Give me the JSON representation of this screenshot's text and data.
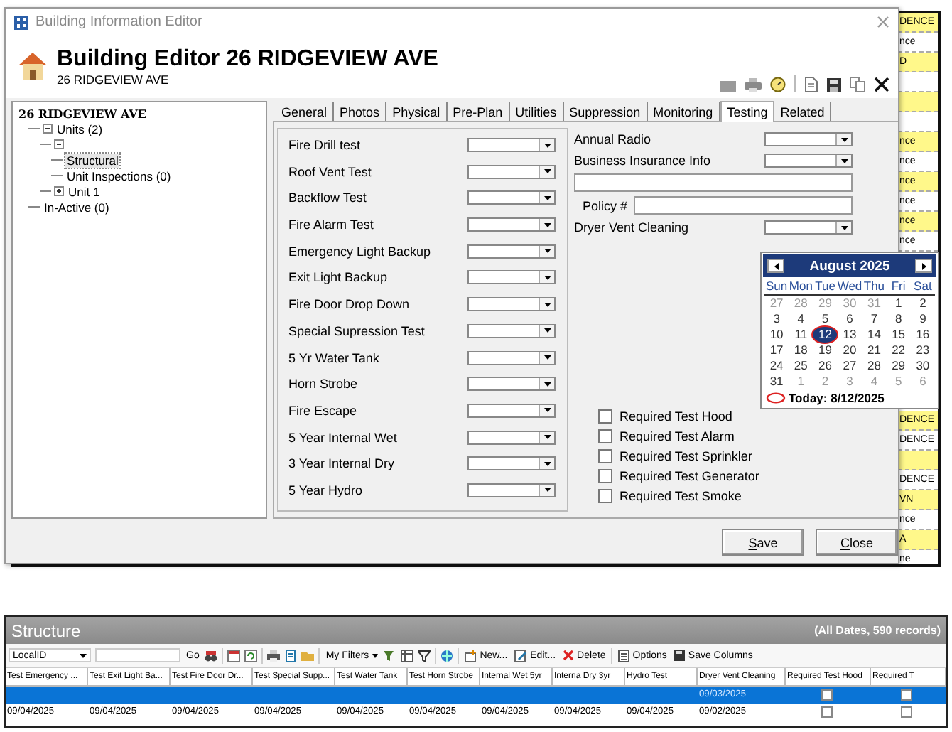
{
  "background_list": {
    "rows": [
      {
        "text": "DENCE",
        "highlighted": true
      },
      {
        "text": "nce",
        "highlighted": false
      },
      {
        "text": "D",
        "highlighted": true
      },
      {
        "highlighted": false
      },
      {
        "highlighted": true
      },
      {
        "highlighted": false
      },
      {
        "text": "nce",
        "highlighted": true
      },
      {
        "text": "nce",
        "highlighted": false
      },
      {
        "text": "nce",
        "highlighted": true
      },
      {
        "text": "nce",
        "highlighted": false
      },
      {
        "text": "nce",
        "highlighted": true
      },
      {
        "text": "nce",
        "highlighted": false
      }
    ],
    "rows_below_calendar": [
      {
        "text": "DENCE",
        "highlighted": true
      },
      {
        "text": "DENCE",
        "highlighted": false
      },
      {
        "highlighted": true
      },
      {
        "text": "DENCE",
        "highlighted": false
      },
      {
        "text": "VN",
        "highlighted": true
      },
      {
        "text": "nce",
        "highlighted": false
      },
      {
        "text": "A",
        "highlighted": true
      },
      {
        "text": "ne",
        "highlighted": false
      }
    ]
  },
  "dialog": {
    "title": "Building Information Editor",
    "heading": "Building Editor 26 RIDGEVIEW AVE",
    "subheading": "26 RIDGEVIEW AVE",
    "tree": [
      {
        "label": "26 RIDGEVIEW AVE",
        "selected": false,
        "children": [
          {
            "label": "Units (2)",
            "selected": false,
            "expanded": true,
            "children": [
              {
                "expanded": true,
                "children": [
                  {
                    "label": "Structural",
                    "selected": true
                  },
                  {
                    "label": "Unit Inspections (0)",
                    "selected": false
                  }
                ]
              },
              {
                "label": "Unit 1",
                "selected": false,
                "expanded": false
              }
            ]
          },
          {
            "label": "In-Active (0)",
            "selected": false
          }
        ]
      }
    ],
    "tabs": [
      {
        "label": "General",
        "selected": false
      },
      {
        "label": "Photos",
        "selected": false
      },
      {
        "label": "Physical",
        "selected": false
      },
      {
        "label": "Pre-Plan",
        "selected": false
      },
      {
        "label": "Utilities",
        "selected": false
      },
      {
        "label": "Suppression",
        "selected": false
      },
      {
        "label": "Monitoring",
        "selected": false
      },
      {
        "label": "Testing",
        "selected": true
      },
      {
        "label": "Related",
        "selected": false
      }
    ],
    "test_fields": [
      "Fire Drill test",
      "Roof Vent Test",
      "Backflow Test",
      "Fire Alarm Test",
      "Emergency Light Backup",
      "Exit Light Backup",
      "Fire Door Drop Down",
      "Special Supression Test",
      "5 Yr Water Tank",
      "Horn Strobe",
      "Fire Escape",
      "5 Year Internal Wet",
      "3 Year Internal Dry",
      "5 Year Hydro"
    ],
    "side_fields": [
      {
        "kind": "dropdown",
        "label": "Annual Radio"
      },
      {
        "kind": "dropdown",
        "label": "Business Insurance Info"
      },
      {
        "kind": "text"
      },
      {
        "kind": "text",
        "label": "Policy #"
      },
      {
        "kind": "dropdown",
        "label": "Dryer Vent Cleaning"
      }
    ],
    "checkboxes": [
      {
        "label": "Required Test Hood",
        "checked": false
      },
      {
        "label": "Required Test Alarm",
        "checked": false
      },
      {
        "label": "Required Test Sprinkler",
        "checked": false
      },
      {
        "label": "Required Test Generator",
        "checked": false
      },
      {
        "label": "Required Test Smoke",
        "checked": false
      }
    ],
    "calendar": {
      "month": "August 2025",
      "weekdays": [
        "Sun",
        "Mon",
        "Tue",
        "Wed",
        "Thu",
        "Fri",
        "Sat"
      ],
      "weeks": [
        [
          {
            "day": "27",
            "other_month": true,
            "selected": false
          },
          {
            "day": "28",
            "other_month": true,
            "selected": false
          },
          {
            "day": "29",
            "other_month": true,
            "selected": false
          },
          {
            "day": "30",
            "other_month": true,
            "selected": false
          },
          {
            "day": "31",
            "other_month": true,
            "selected": false
          },
          {
            "day": "1",
            "other_month": false,
            "selected": false
          },
          {
            "day": "2",
            "other_month": false,
            "selected": false
          }
        ],
        [
          {
            "day": "3",
            "other_month": false,
            "selected": false
          },
          {
            "day": "4",
            "other_month": false,
            "selected": false
          },
          {
            "day": "5",
            "other_month": false,
            "selected": false
          },
          {
            "day": "6",
            "other_month": false,
            "selected": false
          },
          {
            "day": "7",
            "other_month": false,
            "selected": false
          },
          {
            "day": "8",
            "other_month": false,
            "selected": false
          },
          {
            "day": "9",
            "other_month": false,
            "selected": false
          }
        ],
        [
          {
            "day": "10",
            "other_month": false,
            "selected": false
          },
          {
            "day": "11",
            "other_month": false,
            "selected": false
          },
          {
            "day": "12",
            "other_month": false,
            "selected": true
          },
          {
            "day": "13",
            "other_month": false,
            "selected": false
          },
          {
            "day": "14",
            "other_month": false,
            "selected": false
          },
          {
            "day": "15",
            "other_month": false,
            "selected": false
          },
          {
            "day": "16",
            "other_month": false,
            "selected": false
          }
        ],
        [
          {
            "day": "17",
            "other_month": false,
            "selected": false
          },
          {
            "day": "18",
            "other_month": false,
            "selected": false
          },
          {
            "day": "19",
            "other_month": false,
            "selected": false
          },
          {
            "day": "20",
            "other_month": false,
            "selected": false
          },
          {
            "day": "21",
            "other_month": false,
            "selected": false
          },
          {
            "day": "22",
            "other_month": false,
            "selected": false
          },
          {
            "day": "23",
            "other_month": false,
            "selected": false
          }
        ],
        [
          {
            "day": "24",
            "other_month": false,
            "selected": false
          },
          {
            "day": "25",
            "other_month": false,
            "selected": false
          },
          {
            "day": "26",
            "other_month": false,
            "selected": false
          },
          {
            "day": "27",
            "other_month": false,
            "selected": false
          },
          {
            "day": "28",
            "other_month": false,
            "selected": false
          },
          {
            "day": "29",
            "other_month": false,
            "selected": false
          },
          {
            "day": "30",
            "other_month": false,
            "selected": false
          }
        ],
        [
          {
            "day": "31",
            "other_month": false,
            "selected": false
          },
          {
            "day": "1",
            "other_month": true,
            "selected": false
          },
          {
            "day": "2",
            "other_month": true,
            "selected": false
          },
          {
            "day": "3",
            "other_month": true,
            "selected": false
          },
          {
            "day": "4",
            "other_month": true,
            "selected": false
          },
          {
            "day": "5",
            "other_month": true,
            "selected": false
          },
          {
            "day": "6",
            "other_month": true,
            "selected": false
          }
        ]
      ],
      "today": "Today: 8/12/2025"
    },
    "buttons": [
      "Save",
      "Close"
    ]
  },
  "grid": {
    "title": "Structure",
    "summary": "(All Dates, 590 records)",
    "toolbar": {
      "field_select": "LocalID",
      "go": "Go",
      "my_filters": "My Filters",
      "new": "New...",
      "edit": "Edit...",
      "delete": "Delete",
      "options": "Options",
      "save_columns": "Save Columns"
    },
    "columns": [
      "Test Emergency ...",
      "Test Exit Light Ba...",
      "Test Fire Door Dr...",
      "Test Special Supp...",
      "Test Water Tank",
      "Test Horn Strobe",
      "Internal Wet 5yr",
      "Interna Dry 3yr",
      "Hydro Test",
      "Dryer Vent Cleaning",
      "Required Test Hood",
      "Required T"
    ],
    "rows": [
      {
        "selected": true,
        "cells": [
          null,
          null,
          null,
          null,
          null,
          null,
          null,
          null,
          null,
          "09/03/2025"
        ],
        "checks": [
          false,
          false
        ]
      },
      {
        "selected": false,
        "cells": [
          "09/04/2025",
          "09/04/2025",
          "09/04/2025",
          "09/04/2025",
          "09/04/2025",
          "09/04/2025",
          "09/04/2025",
          "09/04/2025",
          "09/04/2025",
          "09/02/2025"
        ],
        "checks": [
          false,
          false
        ]
      }
    ]
  }
}
